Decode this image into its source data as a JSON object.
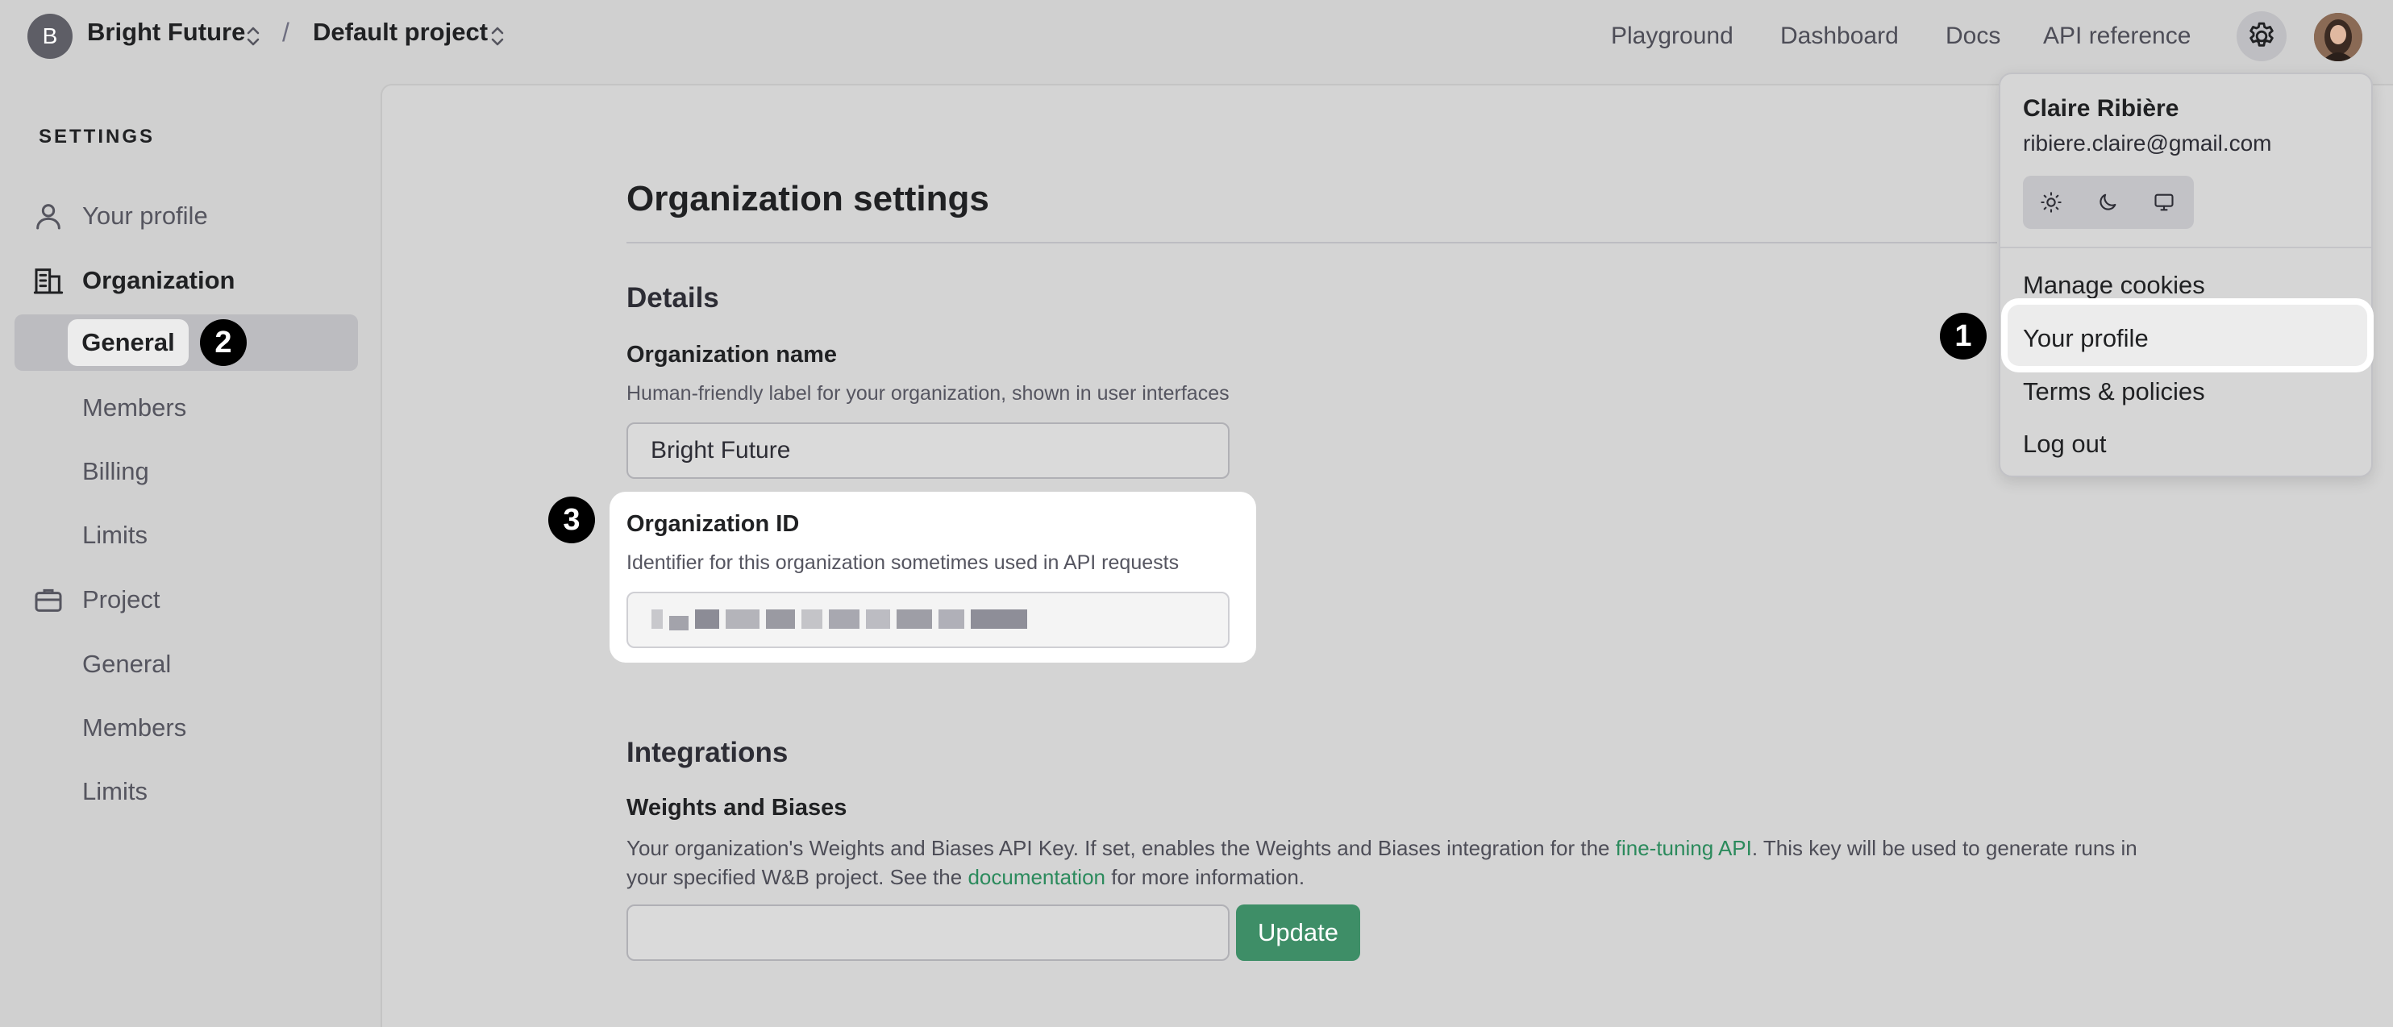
{
  "topbar": {
    "org_initial": "B",
    "org_name": "Bright Future",
    "separator": "/",
    "project_name": "Default project",
    "nav": [
      "Playground",
      "Dashboard",
      "Docs",
      "API reference"
    ]
  },
  "sidebar": {
    "heading": "SETTINGS",
    "your_profile": "Your profile",
    "organization": {
      "label": "Organization",
      "items": [
        "General",
        "Members",
        "Billing",
        "Limits"
      ]
    },
    "project": {
      "label": "Project",
      "items": [
        "General",
        "Members",
        "Limits"
      ]
    }
  },
  "steps": [
    "1",
    "2",
    "3"
  ],
  "main": {
    "title": "Organization settings",
    "details_title": "Details",
    "org_name": {
      "label": "Organization name",
      "help": "Human-friendly label for your organization, shown in user interfaces",
      "value": "Bright Future"
    },
    "org_id": {
      "label": "Organization ID",
      "help": "Identifier for this organization sometimes used in API requests"
    },
    "integrations_title": "Integrations",
    "wandb": {
      "label": "Weights and Biases",
      "help_before_link1": "Your organization's Weights and Biases API Key. If set, enables the Weights and Biases integration for the ",
      "link1": "fine-tuning API",
      "help_between": ". This key will be used to generate runs in your specified W&B project. See the ",
      "link2": "documentation",
      "help_after": " for more information.",
      "input_value": "",
      "button": "Update"
    }
  },
  "dropdown": {
    "user_name": "Claire Ribière",
    "email": "ribiere.claire@gmail.com",
    "items": [
      "Manage cookies",
      "Your profile",
      "Terms & policies",
      "Log out"
    ]
  },
  "colors": {
    "accent_green": "#3e8e67",
    "link_green": "#2b8a5c",
    "badge": "#000000"
  }
}
